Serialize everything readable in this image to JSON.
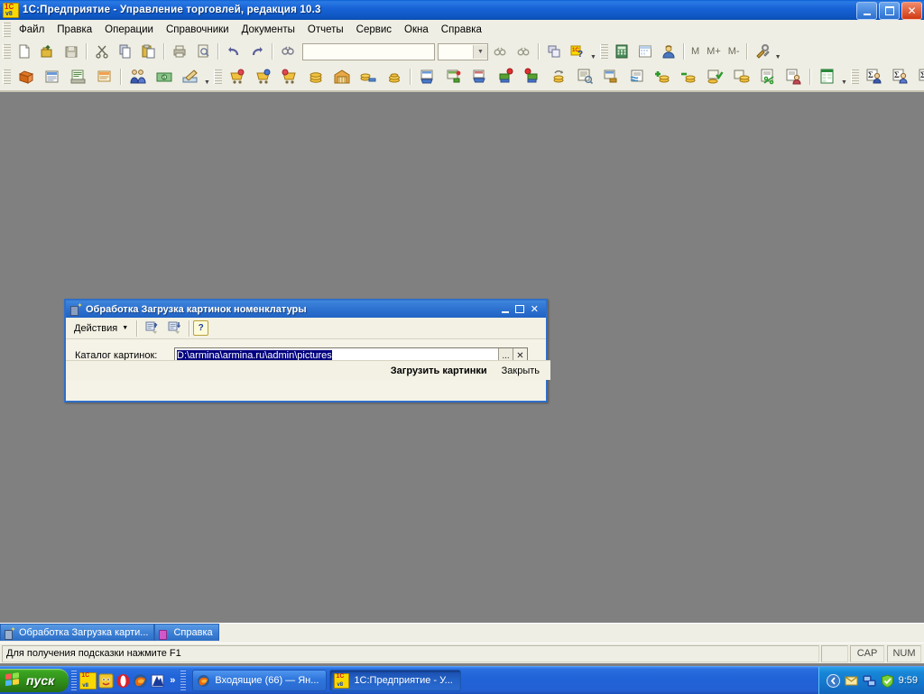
{
  "window": {
    "title": "1С:Предприятие - Управление торговлей, редакция 10.3",
    "icon": "1c-v8-icon",
    "buttons": {
      "minimize": "minimize-icon",
      "maximize": "maximize-icon",
      "close": "close-icon"
    }
  },
  "menubar": {
    "items": [
      {
        "label": "Файл",
        "accel": "Ф"
      },
      {
        "label": "Правка",
        "accel": "П"
      },
      {
        "label": "Операции",
        "accel": ""
      },
      {
        "label": "Справочники",
        "accel": ""
      },
      {
        "label": "Документы",
        "accel": ""
      },
      {
        "label": "Отчеты",
        "accel": ""
      },
      {
        "label": "Сервис",
        "accel": "С"
      },
      {
        "label": "Окна",
        "accel": "О"
      },
      {
        "label": "Справка",
        "accel": ""
      }
    ]
  },
  "toolbar1": {
    "combo_value": "",
    "memory_buttons": [
      "M",
      "M+",
      "M-"
    ],
    "icons": [
      "new-document-icon",
      "open-folder-icon",
      "save-icon",
      "cut-scissors-icon",
      "copy-icon",
      "paste-icon",
      "print-icon",
      "print-preview-icon",
      "undo-icon",
      "redo-icon",
      "find-icon",
      "find-next-icon",
      "find-prev-icon",
      "window-copy-icon",
      "help-1c-icon",
      "calculator-icon",
      "calendar-icon",
      "user-icon",
      "settings-tools-icon"
    ]
  },
  "toolbar2": {
    "icons": [
      "goods-box-icon",
      "invoice-icon",
      "print-doc-icon",
      "order-doc-icon",
      "partners-icon",
      "cash-money-icon",
      "price-edit-icon",
      "buyer-cart-icon",
      "sale-cart-icon",
      "return-cart-icon",
      "coins-icon",
      "warehouse-icon",
      "payment-icon",
      "coin-stack-icon",
      "receipt-cart-icon",
      "receipt-green-icon",
      "purchase-cart-icon",
      "delivery-red-icon",
      "shipment-red-icon",
      "coins-cycle-icon",
      "report-doc-icon",
      "report-green-icon",
      "transfer-icon",
      "currency-icon",
      "add-coins-icon",
      "remove-coins-icon",
      "check-coins-icon",
      "balance-icon",
      "percent-doc-icon",
      "user-doc-icon",
      "excel-icon",
      "report-sum-blue-icon",
      "report-sum-user-icon",
      "report-sum-gray-icon",
      "report-sum-red-icon",
      "report-sum-flag-icon",
      "report-sum-doc-icon",
      "report-list-icon",
      "report-check-icon"
    ]
  },
  "dialog": {
    "title": "Обработка  Загрузка картинок номенклатуры",
    "icon": "processing-icon",
    "titlebar_buttons": {
      "minimize": "minimize-icon",
      "maximize": "maximize-icon",
      "close": "close-icon"
    },
    "toolbar": {
      "actions_label": "Действия",
      "actions_caret": "▼",
      "icon_buttons": [
        "save-and-close-icon",
        "save-record-icon"
      ],
      "help_label": "?"
    },
    "field": {
      "label": "Каталог картинок:",
      "value": "D:\\armina\\armina.ru\\admin\\pictures",
      "selected": true,
      "browse_label": "...",
      "clear_label": "✕"
    },
    "footer": {
      "primary_label": "Загрузить картинки",
      "secondary_label": "Закрыть"
    }
  },
  "mdi_tabs": [
    {
      "label": "Обработка  Загрузка карти...",
      "icon": "processing-icon",
      "active": true
    },
    {
      "label": "Справка",
      "icon": "help-book-icon",
      "active": false
    }
  ],
  "statusbar": {
    "message": "Для получения подсказки нажмите F1",
    "caps": "CAP",
    "num": "NUM"
  },
  "taskbar": {
    "start_label": "пуск",
    "quicklaunch": [
      "1c-v8-icon",
      "app-yellow-icon",
      "opera-icon",
      "firefox-icon",
      "blue-doc-icon"
    ],
    "quicklaunch_chevron": "»",
    "tasks": [
      {
        "label": "Входящие (66) — Ян...",
        "icon": "firefox-icon",
        "active": false
      },
      {
        "label": "1C:Предприятие - У...",
        "icon": "1c-v8-icon",
        "active": true
      }
    ],
    "tray": {
      "chevron": "show-hidden-icons-icon",
      "icons": [
        "mail-icon",
        "network-icon",
        "security-shield-icon"
      ],
      "clock": "9:59"
    }
  },
  "colors": {
    "title_blue": "#1763d6",
    "desktop_gray": "#808080",
    "toolbar_cream": "#efeee4",
    "dialog_body": "#f5f3e7",
    "selection_navy": "#000080",
    "taskbar_blue": "#2163d8",
    "start_green": "#3ba421"
  }
}
